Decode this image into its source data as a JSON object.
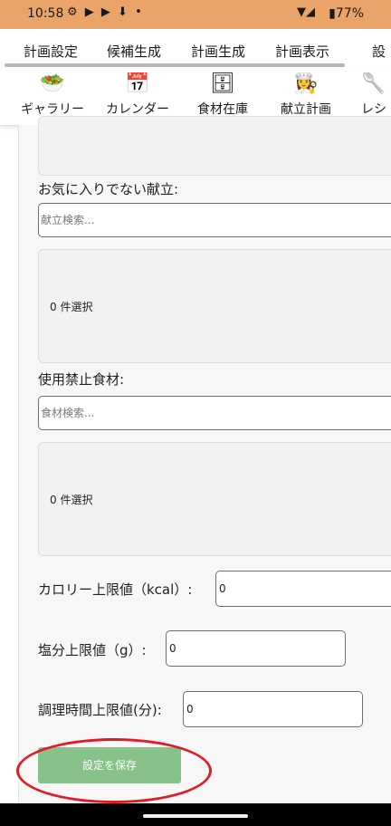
{
  "status_bar": {
    "time": "10:58",
    "icons": "⚙ ▶ ▶ ⬇ •",
    "signal": "▼◢",
    "battery": "▮77%"
  },
  "top_tabs": [
    "計画設定",
    "候補生成",
    "計画生成",
    "計画表示",
    "設"
  ],
  "nav2": [
    {
      "emoji": "🥗",
      "label": "ギャラリー"
    },
    {
      "emoji": "📅",
      "label": "カレンダー"
    },
    {
      "emoji": "🗄",
      "label": "食材在庫"
    },
    {
      "emoji": "👩‍🍳",
      "label": "献立計画"
    },
    {
      "emoji": "🥄",
      "label": "レシ"
    }
  ],
  "form": {
    "disliked_label": "お気に入りでない献立:",
    "disliked_search_placeholder": "献立検索...",
    "disliked_selected": "0 件選択",
    "banned_label": "使用禁止食材:",
    "banned_search_placeholder": "食材検索...",
    "banned_selected": "0 件選択",
    "calorie_label": "カロリー上限値（kcal）:",
    "calorie_value": "0",
    "salt_label": "塩分上限値（g）:",
    "salt_value": "0",
    "time_label": "調理時間上限値(分):",
    "time_value": "0",
    "chevron": "⌄"
  },
  "save_button": "設定を保存",
  "colors": {
    "status_bar": "#eba468",
    "save_button": "#86c289",
    "annotation_circle": "#e01b24"
  }
}
